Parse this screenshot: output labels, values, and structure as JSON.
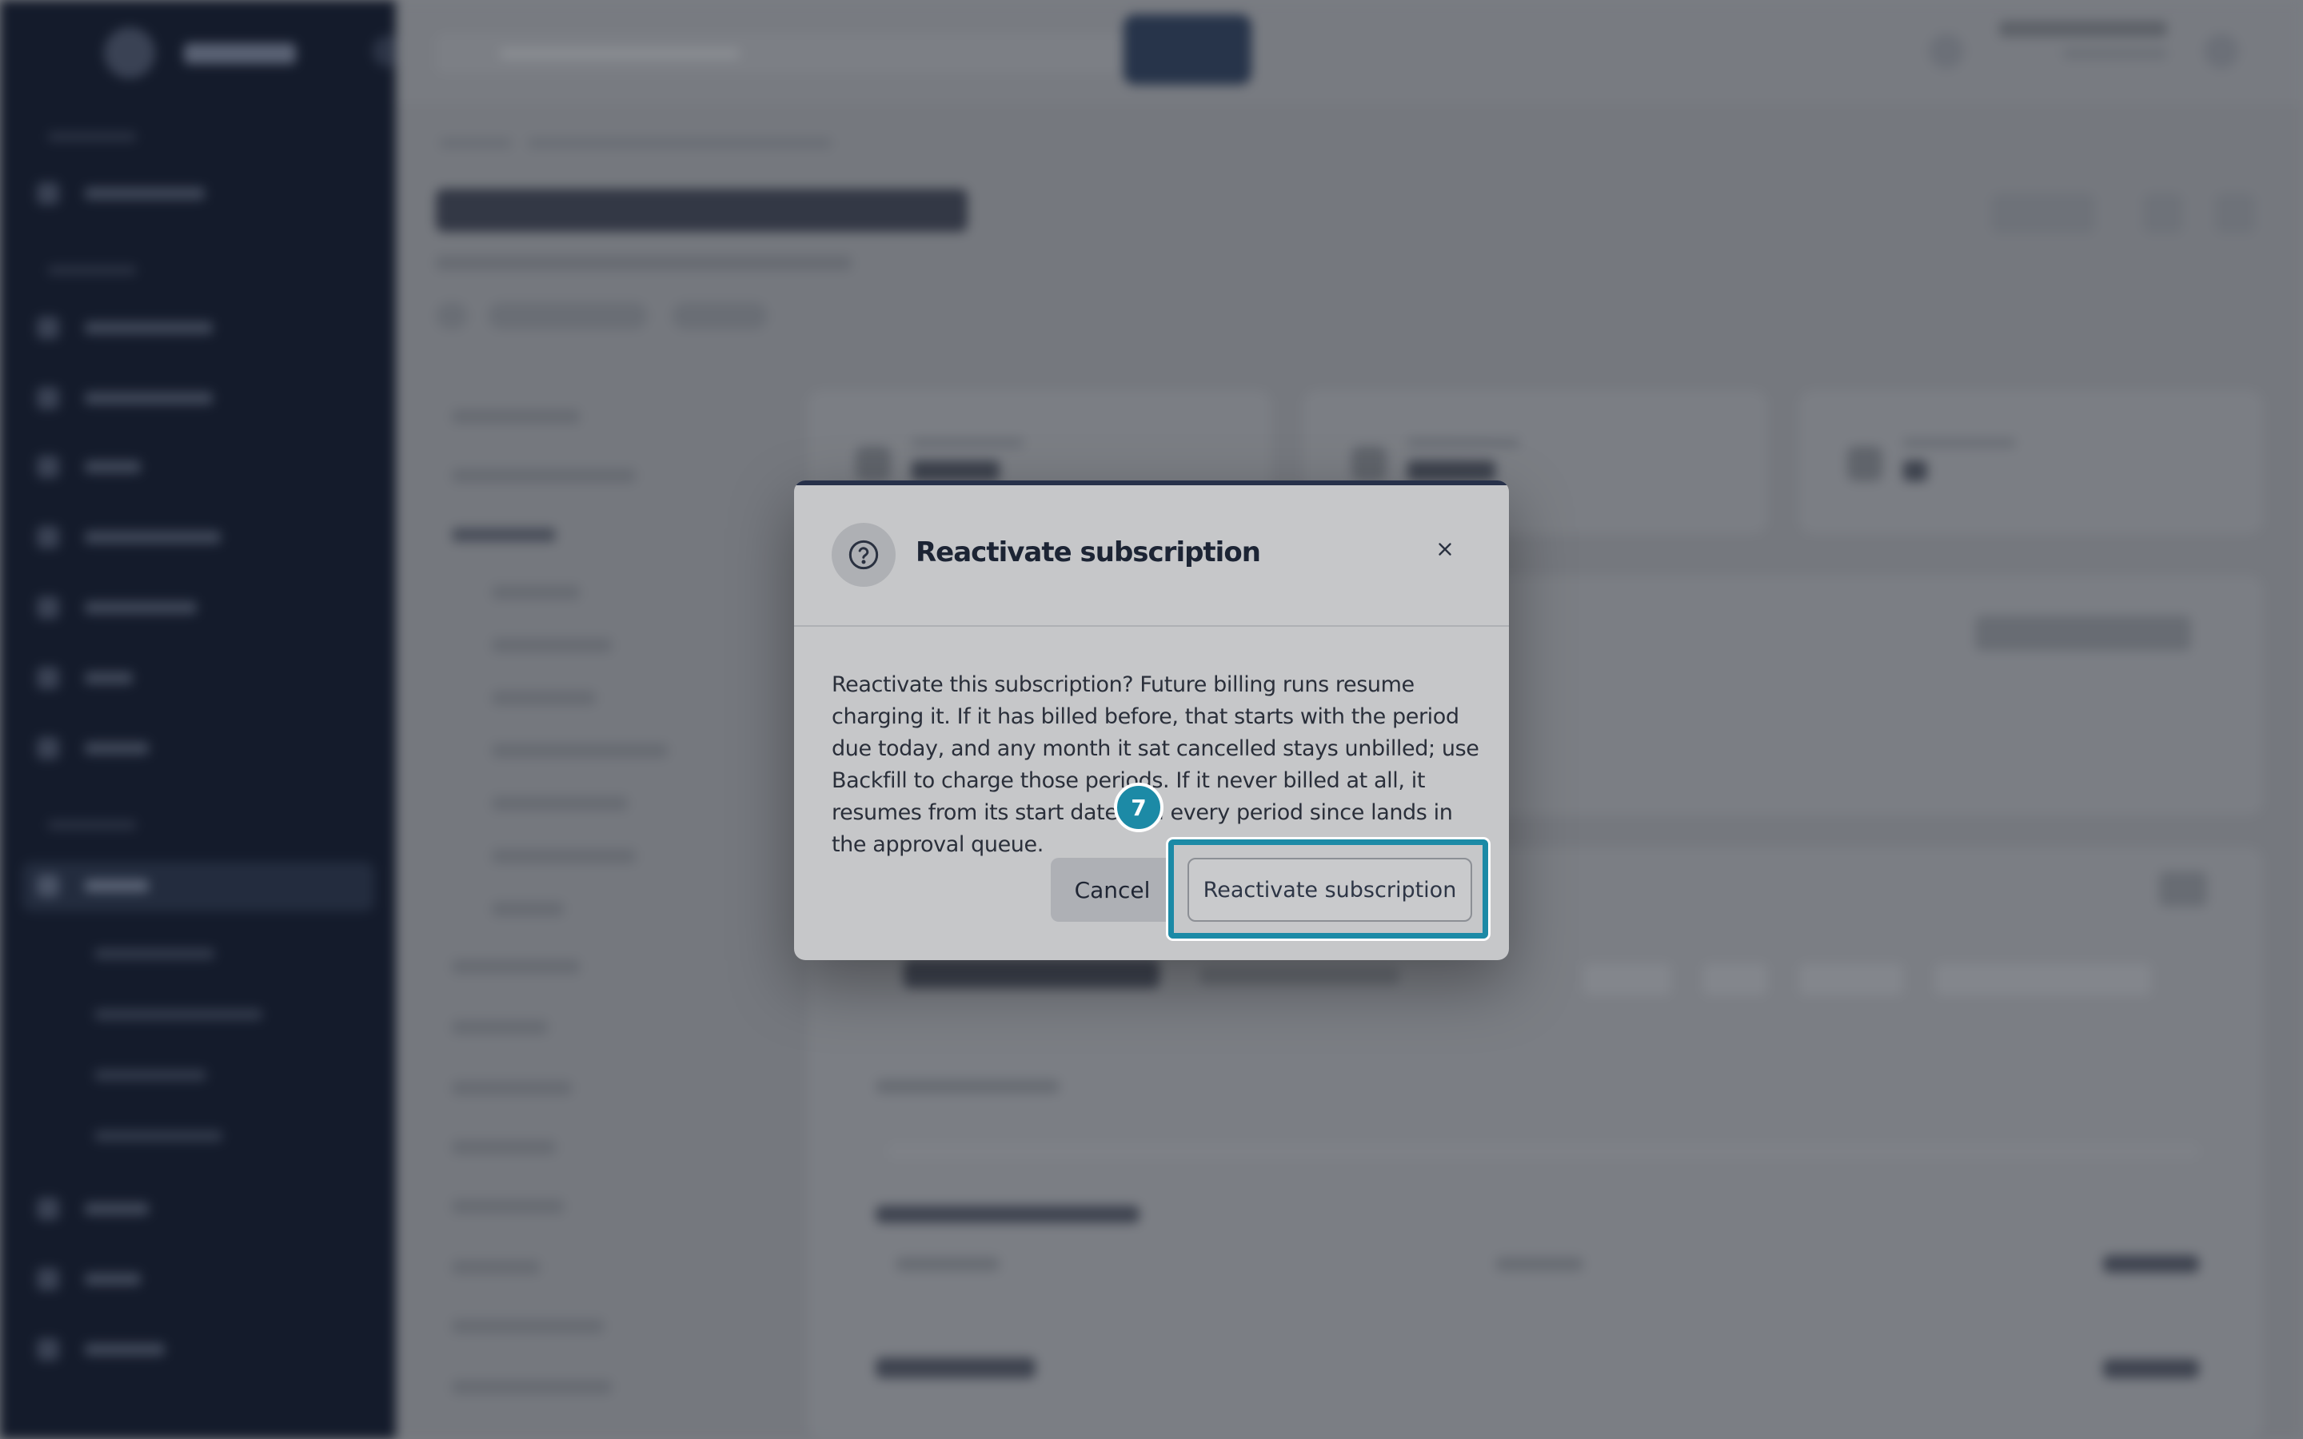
{
  "modal": {
    "title": "Reactivate subscription",
    "body": "Reactivate this subscription? Future billing runs resume charging it. If it has billed before, that starts with the period due today, and any month it sat cancelled stays unbilled; use Backfill to charge those periods. If it never billed at all, it resumes from its start date and every period since lands in the approval queue.",
    "cancel_label": "Cancel",
    "confirm_label": "Reactivate subscription",
    "icons": {
      "header": "help-circle-icon",
      "close": "close-icon"
    }
  },
  "annotation": {
    "step_number": "7",
    "color": "#1c8aa6"
  },
  "colors": {
    "sidebar": "#141b2b",
    "modal_background": "#c6c7c9",
    "title_text": "#1c2434"
  }
}
